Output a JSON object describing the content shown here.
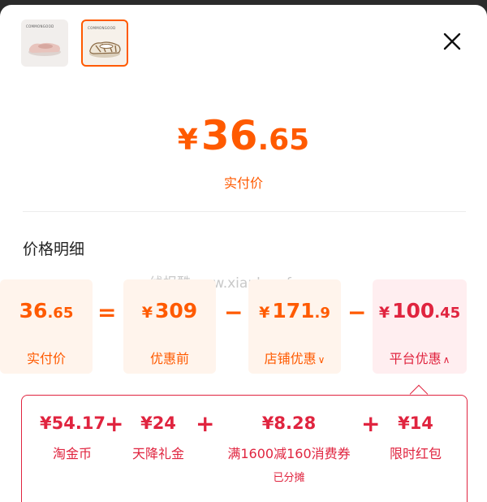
{
  "thumbnails": [
    {
      "brand": "COMMONGOOD",
      "alt": "pink-flat-shoe"
    },
    {
      "brand": "COMMONGOOD",
      "alt": "beige-sandal",
      "selected": true
    }
  ],
  "summary": {
    "currency": "¥",
    "price_int": "36",
    "price_dec": ".65",
    "label": "实付价"
  },
  "section_title": "价格明细",
  "watermark": "线报酷-new.xianbao.fun",
  "breakdown": {
    "actual": {
      "int": "36",
      "dec": ".65",
      "label": "实付价"
    },
    "equals": "=",
    "before": {
      "currency": "¥",
      "int": "309",
      "dec": "",
      "label": "优惠前"
    },
    "minus1": "−",
    "shop": {
      "currency": "¥",
      "int": "171",
      "dec": ".9",
      "label": "店铺优惠",
      "chevron": "∨"
    },
    "minus2": "−",
    "platform": {
      "currency": "¥",
      "int": "100",
      "dec": ".45",
      "label": "平台优惠",
      "chevron": "∧"
    }
  },
  "platform_details": {
    "items": [
      {
        "amount": "¥54.17",
        "name": "淘金币",
        "note": ""
      },
      {
        "amount": "¥24",
        "name": "天降礼金",
        "note": ""
      },
      {
        "amount": "¥8.28",
        "name": "满1600减160消费券",
        "note": "已分摊"
      },
      {
        "amount": "¥14",
        "name": "限时红包",
        "note": ""
      }
    ],
    "plus": "+"
  },
  "colors": {
    "accent_orange": "#ff5a00",
    "accent_red": "#e0243f",
    "card_orange_bg": "#fff4ec",
    "card_red_bg": "#ffeef0"
  },
  "icons": {
    "close": "close-icon",
    "chevron_down": "chevron-down-icon",
    "chevron_up": "chevron-up-icon"
  }
}
